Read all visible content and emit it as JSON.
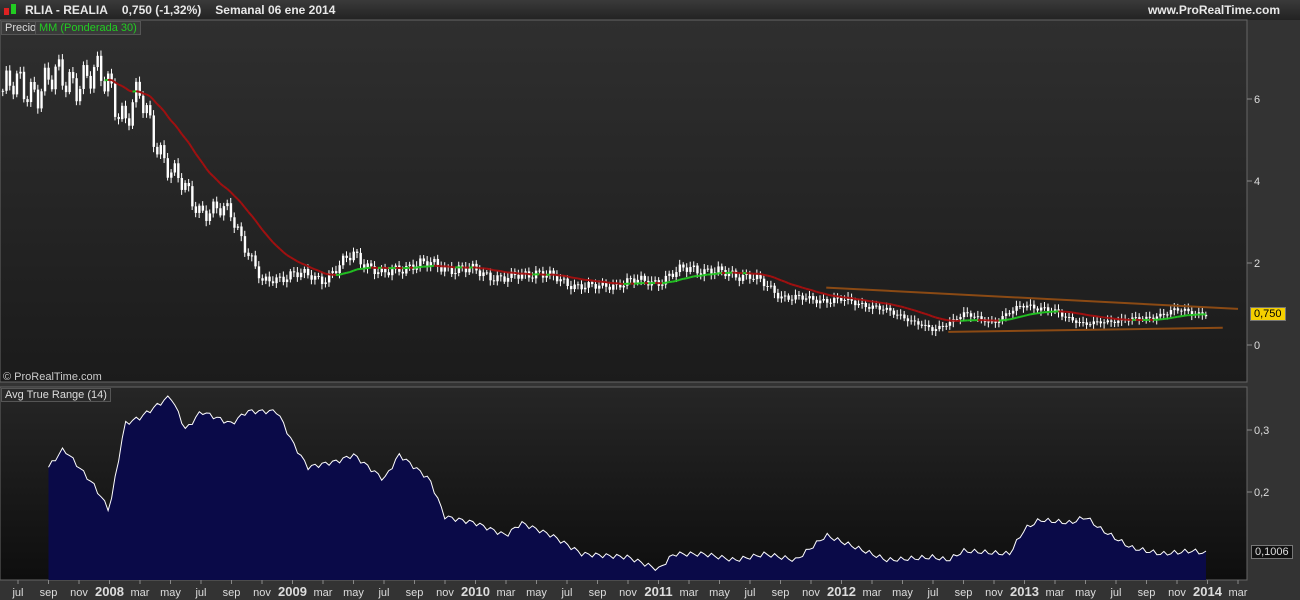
{
  "header": {
    "symbol": "RLIA - REALIA",
    "price": "0,750 (-1,32%)",
    "period": "Semanal  06 ene 2014",
    "site": "www.ProRealTime.com"
  },
  "panel1": {
    "label_price": "Precio",
    "label_ma": "MM (Ponderada 30)",
    "copyright": "© ProRealTime.com",
    "last_value": "0,750"
  },
  "panel2": {
    "label": "Avg True Range (14)",
    "last_value": "0,1006"
  },
  "colors": {
    "ma_up": "#22c022",
    "ma_down": "#a01010",
    "trend": "#8b4a14",
    "atr_fill": "#0a0a48",
    "last_price_bg": "#f5d000"
  },
  "chart_data": [
    {
      "type": "candlestick",
      "title": "RLIA - REALIA",
      "period": "weekly",
      "y_ticks": [
        "0",
        "2",
        "4",
        "6"
      ],
      "y_tick_values": [
        0,
        2,
        4,
        6
      ],
      "ylim": [
        -0.85,
        7.9
      ],
      "price_keypoints": [
        [
          "2007-06",
          6.2
        ],
        [
          "2007-08",
          6.3
        ],
        [
          "2007-11",
          6.55
        ],
        [
          "2008-01",
          6.4
        ],
        [
          "2008-02",
          5.5
        ],
        [
          "2008-03",
          6.0
        ],
        [
          "2008-05",
          4.2
        ],
        [
          "2008-07",
          3.3
        ],
        [
          "2008-09",
          3.2
        ],
        [
          "2008-11",
          1.5
        ],
        [
          "2009-01",
          1.75
        ],
        [
          "2009-03",
          1.6
        ],
        [
          "2009-05",
          2.2
        ],
        [
          "2009-07",
          1.7
        ],
        [
          "2009-09",
          2.0
        ],
        [
          "2009-11",
          1.9
        ],
        [
          "2010-01",
          1.8
        ],
        [
          "2010-03",
          1.6
        ],
        [
          "2010-05",
          1.8
        ],
        [
          "2010-07",
          1.5
        ],
        [
          "2010-09",
          1.4
        ],
        [
          "2010-11",
          1.55
        ],
        [
          "2011-01",
          1.55
        ],
        [
          "2011-03",
          1.9
        ],
        [
          "2011-05",
          1.75
        ],
        [
          "2011-07",
          1.7
        ],
        [
          "2011-09",
          1.2
        ],
        [
          "2011-11",
          1.1
        ],
        [
          "2012-01",
          1.1
        ],
        [
          "2012-03",
          0.95
        ],
        [
          "2012-05",
          0.7
        ],
        [
          "2012-07",
          0.35
        ],
        [
          "2012-09",
          0.75
        ],
        [
          "2012-11",
          0.55
        ],
        [
          "2013-01",
          1.0
        ],
        [
          "2013-03",
          0.8
        ],
        [
          "2013-05",
          0.5
        ],
        [
          "2013-07",
          0.6
        ],
        [
          "2013-09",
          0.65
        ],
        [
          "2013-11",
          0.85
        ],
        [
          "2014-01",
          0.75
        ]
      ],
      "trend_lines": [
        {
          "from": [
            "2011-12",
            1.4
          ],
          "to": [
            "2014-03",
            0.88
          ]
        },
        {
          "from": [
            "2012-08",
            0.32
          ],
          "to": [
            "2014-02",
            0.42
          ]
        }
      ],
      "series": [
        {
          "name": "MM (Ponderada 30)",
          "period": 30
        }
      ]
    },
    {
      "type": "area",
      "title": "Avg True Range (14)",
      "y_ticks": [
        "0,2",
        "0,3"
      ],
      "y_tick_values": [
        0.2,
        0.3
      ],
      "ylim": [
        0.056,
        0.37
      ],
      "keypoints": [
        [
          "2007-09",
          0.24
        ],
        [
          "2007-10",
          0.27
        ],
        [
          "2007-12",
          0.21
        ],
        [
          "2008-01",
          0.17
        ],
        [
          "2008-02",
          0.31
        ],
        [
          "2008-03",
          0.32
        ],
        [
          "2008-05",
          0.355
        ],
        [
          "2008-06",
          0.3
        ],
        [
          "2008-07",
          0.33
        ],
        [
          "2008-09",
          0.31
        ],
        [
          "2008-10",
          0.33
        ],
        [
          "2008-12",
          0.33
        ],
        [
          "2009-01",
          0.28
        ],
        [
          "2009-02",
          0.24
        ],
        [
          "2009-04",
          0.25
        ],
        [
          "2009-05",
          0.26
        ],
        [
          "2009-07",
          0.22
        ],
        [
          "2009-08",
          0.26
        ],
        [
          "2009-10",
          0.22
        ],
        [
          "2009-11",
          0.16
        ],
        [
          "2010-01",
          0.15
        ],
        [
          "2010-03",
          0.13
        ],
        [
          "2010-04",
          0.15
        ],
        [
          "2010-06",
          0.13
        ],
        [
          "2010-08",
          0.1
        ],
        [
          "2010-11",
          0.095
        ],
        [
          "2011-01",
          0.075
        ],
        [
          "2011-02",
          0.1
        ],
        [
          "2011-04",
          0.1
        ],
        [
          "2011-06",
          0.09
        ],
        [
          "2011-08",
          0.1
        ],
        [
          "2011-10",
          0.09
        ],
        [
          "2011-12",
          0.13
        ],
        [
          "2012-03",
          0.1
        ],
        [
          "2012-04",
          0.09
        ],
        [
          "2012-07",
          0.095
        ],
        [
          "2012-08",
          0.09
        ],
        [
          "2012-09",
          0.105
        ],
        [
          "2012-12",
          0.1
        ],
        [
          "2013-01",
          0.14
        ],
        [
          "2013-02",
          0.155
        ],
        [
          "2013-04",
          0.15
        ],
        [
          "2013-05",
          0.16
        ],
        [
          "2013-06",
          0.14
        ],
        [
          "2013-08",
          0.11
        ],
        [
          "2013-10",
          0.1
        ],
        [
          "2013-12",
          0.105
        ],
        [
          "2014-01",
          0.1006
        ]
      ]
    }
  ],
  "x_axis": {
    "labels": [
      [
        "jul",
        "2007-07"
      ],
      [
        "sep",
        "2007-09"
      ],
      [
        "nov",
        "2007-11"
      ],
      [
        "2008",
        "2008-01"
      ],
      [
        "mar",
        "2008-03"
      ],
      [
        "may",
        "2008-05"
      ],
      [
        "jul",
        "2008-07"
      ],
      [
        "sep",
        "2008-09"
      ],
      [
        "nov",
        "2008-11"
      ],
      [
        "2009",
        "2009-01"
      ],
      [
        "mar",
        "2009-03"
      ],
      [
        "may",
        "2009-05"
      ],
      [
        "jul",
        "2009-07"
      ],
      [
        "sep",
        "2009-09"
      ],
      [
        "nov",
        "2009-11"
      ],
      [
        "2010",
        "2010-01"
      ],
      [
        "mar",
        "2010-03"
      ],
      [
        "may",
        "2010-05"
      ],
      [
        "jul",
        "2010-07"
      ],
      [
        "sep",
        "2010-09"
      ],
      [
        "nov",
        "2010-11"
      ],
      [
        "2011",
        "2011-01"
      ],
      [
        "mar",
        "2011-03"
      ],
      [
        "may",
        "2011-05"
      ],
      [
        "jul",
        "2011-07"
      ],
      [
        "sep",
        "2011-09"
      ],
      [
        "nov",
        "2011-11"
      ],
      [
        "2012",
        "2012-01"
      ],
      [
        "mar",
        "2012-03"
      ],
      [
        "may",
        "2012-05"
      ],
      [
        "jul",
        "2012-07"
      ],
      [
        "sep",
        "2012-09"
      ],
      [
        "nov",
        "2012-11"
      ],
      [
        "2013",
        "2013-01"
      ],
      [
        "mar",
        "2013-03"
      ],
      [
        "may",
        "2013-05"
      ],
      [
        "jul",
        "2013-07"
      ],
      [
        "sep",
        "2013-09"
      ],
      [
        "nov",
        "2013-11"
      ],
      [
        "2014",
        "2014-01"
      ],
      [
        "mar",
        "2014-03"
      ]
    ]
  }
}
